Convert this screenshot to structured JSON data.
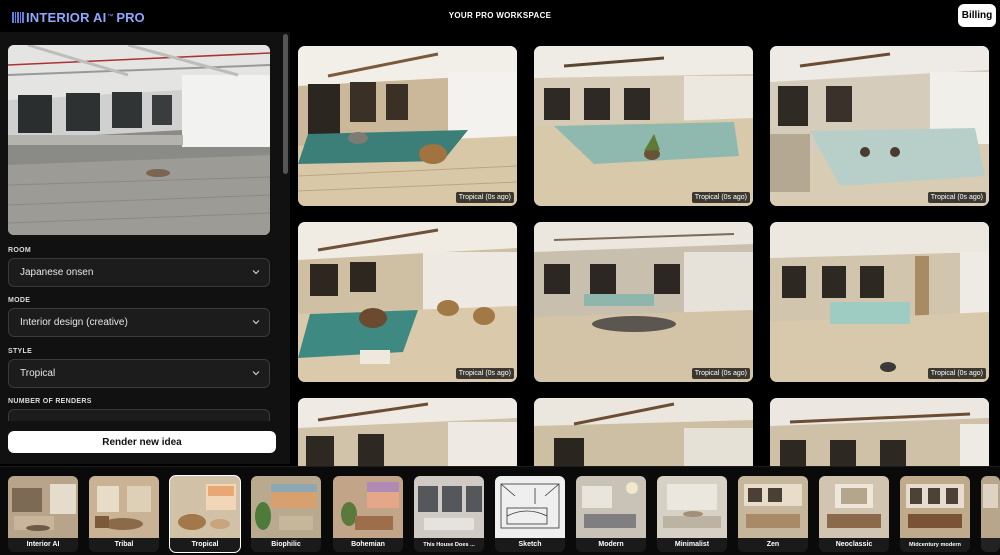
{
  "topbar": {
    "brand": "INTERIOR AI",
    "brand_tm": "™",
    "brand_pro": "PRO",
    "workspace_title": "YOUR PRO WORKSPACE",
    "billing_label": "Billing"
  },
  "sidebar": {
    "room_label": "ROOM",
    "room_value": "Japanese onsen",
    "mode_label": "MODE",
    "mode_value": "Interior design (creative)",
    "style_label": "STYLE",
    "style_value": "Tropical",
    "renders_label": "NUMBER OF RENDERS",
    "render_button_label": "Render new idea"
  },
  "gallery": {
    "items": [
      {
        "caption": "Tropical (0s ago)"
      },
      {
        "caption": "Tropical (0s ago)"
      },
      {
        "caption": "Tropical (0s ago)"
      },
      {
        "caption": "Tropical (0s ago)"
      },
      {
        "caption": "Tropical (0s ago)"
      },
      {
        "caption": "Tropical (0s ago)"
      }
    ]
  },
  "styles": {
    "selected": "Tropical",
    "items": [
      {
        "label": "Interior AI"
      },
      {
        "label": "Tribal"
      },
      {
        "label": "Tropical"
      },
      {
        "label": "Biophilic"
      },
      {
        "label": "Bohemian"
      },
      {
        "label": "This House Does ..."
      },
      {
        "label": "Sketch"
      },
      {
        "label": "Modern"
      },
      {
        "label": "Minimalist"
      },
      {
        "label": "Zen"
      },
      {
        "label": "Neoclassic"
      },
      {
        "label": "Midcentury modern"
      }
    ]
  },
  "colors": {
    "brand": "#8ea8ff",
    "panel": "#111111",
    "select_bg": "#1c1c1c"
  }
}
